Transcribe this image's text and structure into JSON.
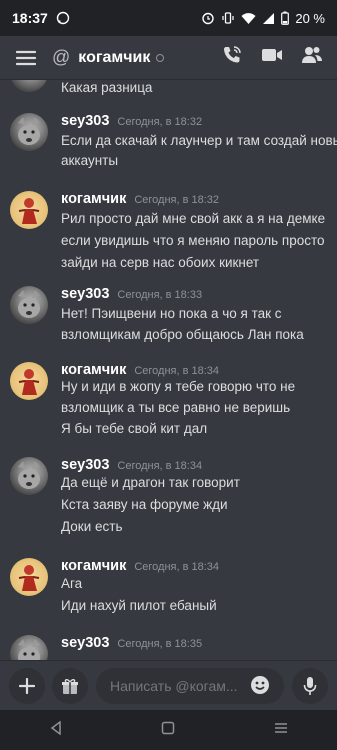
{
  "status_bar": {
    "time": "18:37",
    "battery": "20 %"
  },
  "header": {
    "at_symbol": "@",
    "title": "когамчик"
  },
  "messages": [
    {
      "lines": [
        "Какая разница"
      ]
    },
    {
      "author": "sey303",
      "timestamp": "Сегодня, в 18:32",
      "avatar": "wolf",
      "lines": [
        "Если да скачай к лаунчер и там создай новые",
        "аккаунты"
      ]
    },
    {
      "author": "когамчик",
      "timestamp": "Сегодня, в 18:32",
      "avatar": "kogamchik",
      "lines": [
        "Рил просто дай мне свой акк а я на демке",
        "если увидишь что я меняю пароль просто",
        "зайди на серв нас обоих кикнет"
      ]
    },
    {
      "author": "sey303",
      "timestamp": "Сегодня, в 18:33",
      "avatar": "wolf",
      "lines": [
        "Нет! Пэищвени но пока а чо я так с",
        "взломщикам добро общаюсь Лан пока"
      ]
    },
    {
      "author": "когамчик",
      "timestamp": "Сегодня, в 18:34",
      "avatar": "kogamchik",
      "lines": [
        "Ну и иди в жопу я тебе говорю что не",
        "взломщик а ты все равно не веришь",
        "Я бы тебе свой кит дал"
      ]
    },
    {
      "author": "sey303",
      "timestamp": "Сегодня, в 18:34",
      "avatar": "wolf",
      "lines": [
        "Да ещё и драгон так говорит",
        "Кста заяву на форуме жди",
        "Доки есть"
      ]
    },
    {
      "author": "когамчик",
      "timestamp": "Сегодня, в 18:34",
      "avatar": "kogamchik",
      "lines": [
        "Ага",
        "Иди нахуй пилот ебаный"
      ]
    },
    {
      "author": "sey303",
      "timestamp": "Сегодня, в 18:35",
      "avatar": "wolf",
      "lines": []
    }
  ],
  "composer": {
    "placeholder": "Написать @когам..."
  },
  "colors": {
    "background": "#36393f",
    "bar": "#202225",
    "muted": "#8e9297"
  }
}
